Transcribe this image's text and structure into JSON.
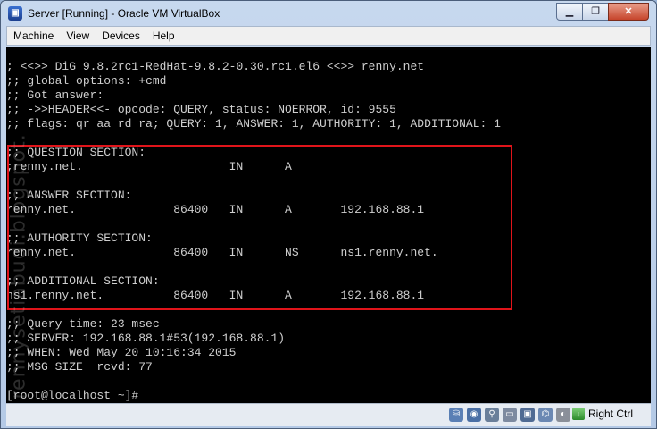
{
  "window": {
    "title": "Server [Running] - Oracle VM VirtualBox",
    "controls": {
      "minimize": "▁",
      "restore": "❐",
      "close": "✕"
    }
  },
  "menu": [
    {
      "label": "Machine"
    },
    {
      "label": "View"
    },
    {
      "label": "Devices"
    },
    {
      "label": "Help"
    }
  ],
  "terminal": {
    "text": "; <<>> DiG 9.8.2rc1-RedHat-9.8.2-0.30.rc1.el6 <<>> renny.net\n;; global options: +cmd\n;; Got answer:\n;; ->>HEADER<<- opcode: QUERY, status: NOERROR, id: 9555\n;; flags: qr aa rd ra; QUERY: 1, ANSWER: 1, AUTHORITY: 1, ADDITIONAL: 1\n\n;; QUESTION SECTION:\n;renny.net.                     IN      A\n\n;; ANSWER SECTION:\nrenny.net.              86400   IN      A       192.168.88.1\n\n;; AUTHORITY SECTION:\nrenny.net.              86400   IN      NS      ns1.renny.net.\n\n;; ADDITIONAL SECTION:\nns1.renny.net.          86400   IN      A       192.168.88.1\n\n;; Query time: 23 msec\n;; SERVER: 192.168.88.1#53(192.168.88.1)\n;; WHEN: Wed May 20 10:16:34 2015\n;; MSG SIZE  rcvd: 77\n\n[root@localhost ~]# _",
    "highlight_color": "#e0141a",
    "watermark": "rennysetiabudi.blogspot.com"
  },
  "statusbar": {
    "icons": [
      {
        "name": "hard-disk-icon",
        "glyph": "⛁",
        "color": "#5a7fb5"
      },
      {
        "name": "optical-drive-icon",
        "glyph": "◉",
        "color": "#4a6fa5"
      },
      {
        "name": "usb-icon",
        "glyph": "⚲",
        "color": "#6a7f9a"
      },
      {
        "name": "shared-folders-icon",
        "glyph": "▭",
        "color": "#7d8aa0"
      },
      {
        "name": "display-icon",
        "glyph": "▣",
        "color": "#4f6a93"
      },
      {
        "name": "network-icon",
        "glyph": "⌬",
        "color": "#6b88b3"
      },
      {
        "name": "mouse-integration-icon",
        "glyph": "◐",
        "color": "#8a8f99"
      }
    ],
    "host_key": "Right Ctrl"
  }
}
